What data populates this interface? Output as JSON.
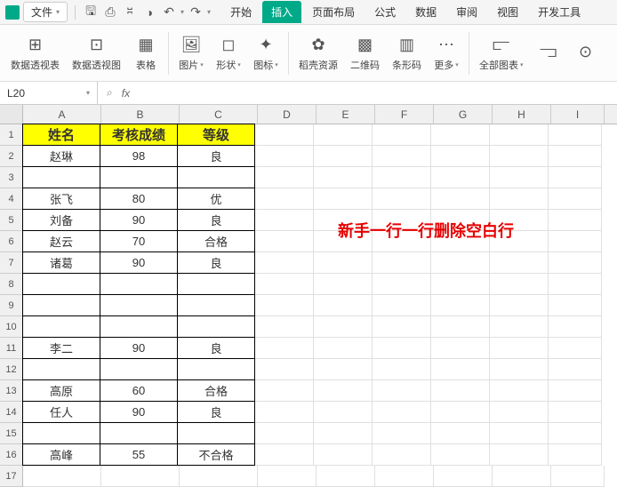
{
  "titlebar": {
    "file_label": "文件",
    "tabs": [
      "开始",
      "插入",
      "页面布局",
      "公式",
      "数据",
      "审阅",
      "视图",
      "开发工具"
    ],
    "active_tab": 1
  },
  "ribbon": {
    "items": [
      {
        "icon": "⊞",
        "label": "数据透视表"
      },
      {
        "icon": "⊡",
        "label": "数据透视图"
      },
      {
        "icon": "▦",
        "label": "表格"
      },
      {
        "icon": "🖼",
        "label": "图片",
        "dd": true
      },
      {
        "icon": "◻",
        "label": "形状",
        "dd": true
      },
      {
        "icon": "✦",
        "label": "图标",
        "dd": true
      },
      {
        "icon": "✿",
        "label": "稻壳资源"
      },
      {
        "icon": "▩",
        "label": "二维码"
      },
      {
        "icon": "▥",
        "label": "条形码"
      },
      {
        "icon": "⋯",
        "label": "更多",
        "dd": true
      },
      {
        "icon": "⫍",
        "label": "全部图表",
        "dd": true
      },
      {
        "icon": "⫎",
        "label": ""
      },
      {
        "icon": "⊙",
        "label": ""
      }
    ]
  },
  "formula": {
    "namebox": "L20",
    "fx": "fx"
  },
  "columns": [
    "A",
    "B",
    "C",
    "D",
    "E",
    "F",
    "G",
    "H",
    "I"
  ],
  "col_widths": [
    "wA",
    "wB",
    "wC",
    "wD",
    "wE",
    "wF",
    "wG",
    "wH",
    "wI"
  ],
  "row_count": 17,
  "header_row": {
    "c0": "姓名",
    "c1": "考核成绩",
    "c2": "等级"
  },
  "data_rows": {
    "2": {
      "c0": "赵琳",
      "c1": "98",
      "c2": "良"
    },
    "3": {
      "c0": "",
      "c1": "",
      "c2": ""
    },
    "4": {
      "c0": "张飞",
      "c1": "80",
      "c2": "优"
    },
    "5": {
      "c0": "刘备",
      "c1": "90",
      "c2": "良"
    },
    "6": {
      "c0": "赵云",
      "c1": "70",
      "c2": "合格"
    },
    "7": {
      "c0": "诸葛",
      "c1": "90",
      "c2": "良"
    },
    "8": {
      "c0": "",
      "c1": "",
      "c2": ""
    },
    "9": {
      "c0": "",
      "c1": "",
      "c2": ""
    },
    "10": {
      "c0": "",
      "c1": "",
      "c2": ""
    },
    "11": {
      "c0": "李二",
      "c1": "90",
      "c2": "良"
    },
    "12": {
      "c0": "",
      "c1": "",
      "c2": ""
    },
    "13": {
      "c0": "高原",
      "c1": "60",
      "c2": "合格"
    },
    "14": {
      "c0": "任人",
      "c1": "90",
      "c2": "良"
    },
    "15": {
      "c0": "",
      "c1": "",
      "c2": ""
    },
    "16": {
      "c0": "高峰",
      "c1": "55",
      "c2": "不合格"
    }
  },
  "annotation_text": "新手一行一行删除空白行",
  "chart_data": {
    "type": "table",
    "title": "",
    "columns": [
      "姓名",
      "考核成绩",
      "等级"
    ],
    "rows": [
      [
        "赵琳",
        98,
        "良"
      ],
      [
        "",
        null,
        ""
      ],
      [
        "张飞",
        80,
        "优"
      ],
      [
        "刘备",
        90,
        "良"
      ],
      [
        "赵云",
        70,
        "合格"
      ],
      [
        "诸葛",
        90,
        "良"
      ],
      [
        "",
        null,
        ""
      ],
      [
        "",
        null,
        ""
      ],
      [
        "",
        null,
        ""
      ],
      [
        "李二",
        90,
        "良"
      ],
      [
        "",
        null,
        ""
      ],
      [
        "高原",
        60,
        "合格"
      ],
      [
        "任人",
        90,
        "良"
      ],
      [
        "",
        null,
        ""
      ],
      [
        "高峰",
        55,
        "不合格"
      ]
    ]
  }
}
